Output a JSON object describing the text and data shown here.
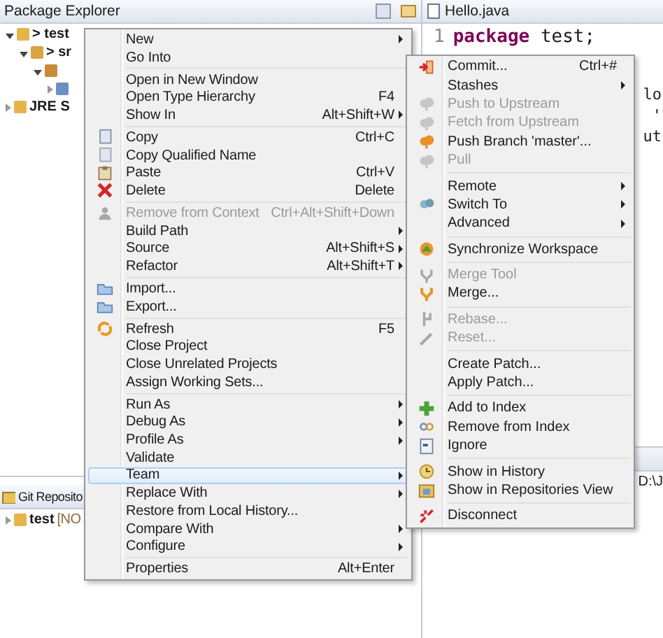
{
  "package_explorer": {
    "title": "Package Explorer",
    "tree": [
      {
        "label": "> test",
        "expanded": true,
        "children": [
          {
            "label": "> sr",
            "expanded": true,
            "children": [
              {
                "expanded": true,
                "children": [
                  {
                    "expanded": false
                  }
                ]
              }
            ]
          }
        ]
      },
      {
        "label": "JRE S",
        "expanded": false
      }
    ]
  },
  "git_repositories": {
    "title": "Git Reposito",
    "tree": [
      {
        "label": "test",
        "decoration": "[NO",
        "expanded": false
      }
    ]
  },
  "editor": {
    "tab": "Hello.java",
    "lines": [
      {
        "number": "1",
        "keyword": "package",
        "text": " test;"
      }
    ],
    "fragments": [
      "lo",
      "'",
      "ut"
    ],
    "console_path": "D:\\J"
  },
  "context_menu": {
    "items": [
      {
        "kind": "item",
        "label": "New",
        "submenu": true,
        "disabled": false,
        "selected": false
      },
      {
        "kind": "item",
        "label": "Go Into",
        "submenu": false,
        "disabled": false,
        "selected": false
      },
      {
        "kind": "separator"
      },
      {
        "kind": "item",
        "label": "Open in New Window",
        "submenu": false,
        "disabled": false,
        "selected": false
      },
      {
        "kind": "item",
        "label": "Open Type Hierarchy",
        "shortcut": "F4",
        "submenu": false,
        "disabled": false,
        "selected": false
      },
      {
        "kind": "item",
        "label": "Show In",
        "shortcut": "Alt+Shift+W",
        "submenu": true,
        "disabled": false,
        "selected": false
      },
      {
        "kind": "separator"
      },
      {
        "kind": "item",
        "label": "Copy",
        "shortcut": "Ctrl+C",
        "submenu": false,
        "disabled": false,
        "selected": false
      },
      {
        "kind": "item",
        "label": "Copy Qualified Name",
        "submenu": false,
        "disabled": false,
        "selected": false
      },
      {
        "kind": "item",
        "label": "Paste",
        "shortcut": "Ctrl+V",
        "submenu": false,
        "disabled": false,
        "selected": false
      },
      {
        "kind": "item",
        "label": "Delete",
        "shortcut": "Delete",
        "submenu": false,
        "disabled": false,
        "selected": false
      },
      {
        "kind": "separator"
      },
      {
        "kind": "item",
        "label": "Remove from Context",
        "shortcut": "Ctrl+Alt+Shift+Down",
        "submenu": false,
        "disabled": true,
        "selected": false
      },
      {
        "kind": "item",
        "label": "Build Path",
        "submenu": true,
        "disabled": false,
        "selected": false
      },
      {
        "kind": "item",
        "label": "Source",
        "shortcut": "Alt+Shift+S",
        "submenu": true,
        "disabled": false,
        "selected": false
      },
      {
        "kind": "item",
        "label": "Refactor",
        "shortcut": "Alt+Shift+T",
        "submenu": true,
        "disabled": false,
        "selected": false
      },
      {
        "kind": "separator"
      },
      {
        "kind": "item",
        "label": "Import...",
        "submenu": false,
        "disabled": false,
        "selected": false
      },
      {
        "kind": "item",
        "label": "Export...",
        "submenu": false,
        "disabled": false,
        "selected": false
      },
      {
        "kind": "separator"
      },
      {
        "kind": "item",
        "label": "Refresh",
        "shortcut": "F5",
        "submenu": false,
        "disabled": false,
        "selected": false
      },
      {
        "kind": "item",
        "label": "Close Project",
        "submenu": false,
        "disabled": false,
        "selected": false
      },
      {
        "kind": "item",
        "label": "Close Unrelated Projects",
        "submenu": false,
        "disabled": false,
        "selected": false
      },
      {
        "kind": "item",
        "label": "Assign Working Sets...",
        "submenu": false,
        "disabled": false,
        "selected": false
      },
      {
        "kind": "separator"
      },
      {
        "kind": "item",
        "label": "Run As",
        "submenu": true,
        "disabled": false,
        "selected": false
      },
      {
        "kind": "item",
        "label": "Debug As",
        "submenu": true,
        "disabled": false,
        "selected": false
      },
      {
        "kind": "item",
        "label": "Profile As",
        "submenu": true,
        "disabled": false,
        "selected": false
      },
      {
        "kind": "item",
        "label": "Validate",
        "submenu": false,
        "disabled": false,
        "selected": false
      },
      {
        "kind": "item",
        "label": "Team",
        "submenu": true,
        "disabled": false,
        "selected": true
      },
      {
        "kind": "item",
        "label": "Replace With",
        "submenu": true,
        "disabled": false,
        "selected": false
      },
      {
        "kind": "item",
        "label": "Restore from Local History...",
        "submenu": false,
        "disabled": false,
        "selected": false
      },
      {
        "kind": "item",
        "label": "Compare With",
        "submenu": true,
        "disabled": false,
        "selected": false
      },
      {
        "kind": "item",
        "label": "Configure",
        "submenu": true,
        "disabled": false,
        "selected": false
      },
      {
        "kind": "separator"
      },
      {
        "kind": "item",
        "label": "Properties",
        "shortcut": "Alt+Enter",
        "submenu": false,
        "disabled": false,
        "selected": false
      }
    ]
  },
  "team_submenu": {
    "items": [
      {
        "kind": "item",
        "label": "Commit...",
        "shortcut": "Ctrl+#",
        "submenu": false,
        "disabled": false,
        "selected": false
      },
      {
        "kind": "item",
        "label": "Stashes",
        "submenu": true,
        "disabled": false,
        "selected": false
      },
      {
        "kind": "item",
        "label": "Push to Upstream",
        "submenu": false,
        "disabled": true,
        "selected": false
      },
      {
        "kind": "item",
        "label": "Fetch from Upstream",
        "submenu": false,
        "disabled": true,
        "selected": false
      },
      {
        "kind": "item",
        "label": "Push Branch 'master'...",
        "submenu": false,
        "disabled": false,
        "selected": false
      },
      {
        "kind": "item",
        "label": "Pull",
        "submenu": false,
        "disabled": true,
        "selected": false
      },
      {
        "kind": "separator"
      },
      {
        "kind": "item",
        "label": "Remote",
        "submenu": true,
        "disabled": false,
        "selected": false
      },
      {
        "kind": "item",
        "label": "Switch To",
        "submenu": true,
        "disabled": false,
        "selected": false
      },
      {
        "kind": "item",
        "label": "Advanced",
        "submenu": true,
        "disabled": false,
        "selected": false
      },
      {
        "kind": "separator"
      },
      {
        "kind": "item",
        "label": "Synchronize Workspace",
        "submenu": false,
        "disabled": false,
        "selected": false
      },
      {
        "kind": "separator"
      },
      {
        "kind": "item",
        "label": "Merge Tool",
        "submenu": false,
        "disabled": true,
        "selected": false
      },
      {
        "kind": "item",
        "label": "Merge...",
        "submenu": false,
        "disabled": false,
        "selected": false
      },
      {
        "kind": "separator"
      },
      {
        "kind": "item",
        "label": "Rebase...",
        "submenu": false,
        "disabled": true,
        "selected": false
      },
      {
        "kind": "item",
        "label": "Reset...",
        "submenu": false,
        "disabled": true,
        "selected": false
      },
      {
        "kind": "separator"
      },
      {
        "kind": "item",
        "label": "Create Patch...",
        "submenu": false,
        "disabled": false,
        "selected": false
      },
      {
        "kind": "item",
        "label": "Apply Patch...",
        "submenu": false,
        "disabled": false,
        "selected": false
      },
      {
        "kind": "separator"
      },
      {
        "kind": "item",
        "label": "Add to Index",
        "submenu": false,
        "disabled": false,
        "selected": false
      },
      {
        "kind": "item",
        "label": "Remove from Index",
        "submenu": false,
        "disabled": false,
        "selected": false
      },
      {
        "kind": "item",
        "label": "Ignore",
        "submenu": false,
        "disabled": false,
        "selected": false
      },
      {
        "kind": "separator"
      },
      {
        "kind": "item",
        "label": "Show in History",
        "submenu": false,
        "disabled": false,
        "selected": false
      },
      {
        "kind": "item",
        "label": "Show in Repositories View",
        "submenu": false,
        "disabled": false,
        "selected": false
      },
      {
        "kind": "separator"
      },
      {
        "kind": "item",
        "label": "Disconnect",
        "submenu": false,
        "disabled": false,
        "selected": false
      }
    ]
  }
}
